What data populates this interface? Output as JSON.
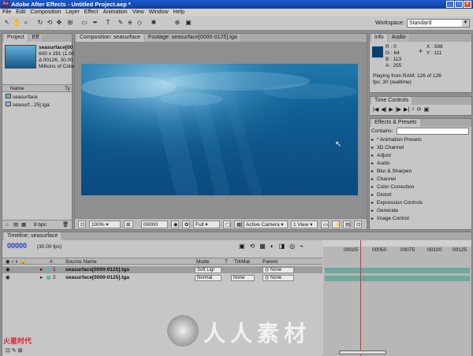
{
  "window": {
    "title": "Adobe After Effects - Untitled Project.aep *"
  },
  "menu": [
    "File",
    "Edit",
    "Composition",
    "Layer",
    "Effect",
    "Animation",
    "View",
    "Window",
    "Help"
  ],
  "workspace": {
    "label": "Workspace:",
    "value": "Standard"
  },
  "project": {
    "tabs": [
      "Project",
      "Eff"
    ],
    "item_name": "seasurface[00",
    "item_size": "600 x 281 (1.00",
    "item_duration": "Δ 00126, 30.00 fp",
    "item_colors": "Millions of Colors",
    "col_name": "Name",
    "col_type": "Ty",
    "items": [
      "seasurface",
      "seasurf...25].tga"
    ],
    "bpc": "8 bpc"
  },
  "comp": {
    "tab_comp": "Composition: seasurface",
    "tab_footage": "Footage: seasurface[0000-0125].tga",
    "zoom": "100%",
    "timecode": "00000",
    "resolution": "Full",
    "camera": "Active Camera",
    "views": "1 View"
  },
  "info": {
    "tabs": [
      "Info",
      "Audio"
    ],
    "r": "R : 0",
    "g": "G : 64",
    "b": "B : 113",
    "a": "A : 255",
    "x": "X : 598",
    "y": "Y : 111",
    "playing": "Playing from RAM: 126 of 126",
    "fps": "fps: 30 (realtime)",
    "swatch_color": "#084071"
  },
  "time_controls": {
    "tab": "Time Controls"
  },
  "effects": {
    "tab": "Effects & Presets",
    "contains_label": "Contains:",
    "items": [
      "* Animation Presets",
      "3D Channel",
      "Adjust",
      "Audio",
      "Blur & Sharpen",
      "Channel",
      "Color Correction",
      "Distort",
      "Expression Controls",
      "Generate",
      "Image Control"
    ]
  },
  "timeline": {
    "tab": "Timeline: seasurface",
    "timecode": "00000",
    "fps": "(30.00 fps)",
    "col_num": "#",
    "col_source": "Source Name",
    "col_mode": "Mode",
    "col_t": "T",
    "col_trkmat": "TrkMat",
    "col_parent": "Parent",
    "ruler": [
      "00025",
      "00050",
      "00075",
      "00100",
      "00125"
    ],
    "layers": [
      {
        "num": "1",
        "name": "seasurface[0000-0125].tga",
        "mode": "Soft Ligl",
        "trkmat": "",
        "parent": "None"
      },
      {
        "num": "2",
        "name": "seasurface[0000-0125].tga",
        "mode": "Normal",
        "trkmat": "None",
        "parent": "None"
      }
    ]
  },
  "watermark": "人人素材",
  "watermark_logo": "火星时代"
}
